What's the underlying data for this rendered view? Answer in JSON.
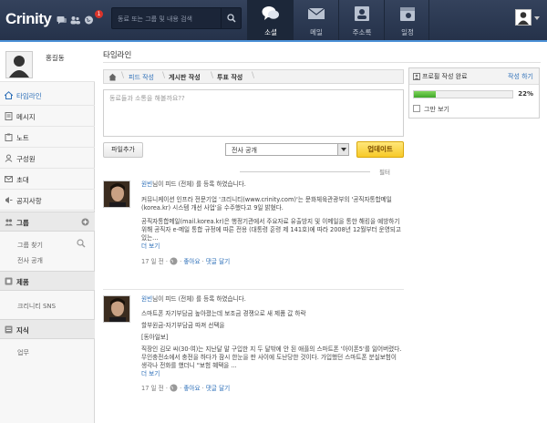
{
  "app": {
    "logo": "Crinity"
  },
  "topbar": {
    "notification_count": "1",
    "search": {
      "placeholder": "동료 또는 그룹 및 내용 검색"
    },
    "nav": [
      {
        "label": "소셜",
        "icon": "chat-bubbles-icon",
        "active": true
      },
      {
        "label": "메일",
        "icon": "envelope-icon",
        "active": false
      },
      {
        "label": "주소록",
        "icon": "contacts-icon",
        "active": false
      },
      {
        "label": "일정",
        "icon": "calendar-icon",
        "active": false
      }
    ]
  },
  "sidebar": {
    "user_name": "홍길동",
    "items": [
      {
        "label": "타임라인",
        "icon": "home-icon",
        "active": true
      },
      {
        "label": "메시지",
        "icon": "message-icon"
      },
      {
        "label": "노트",
        "icon": "note-icon"
      },
      {
        "label": "구성원",
        "icon": "member-icon"
      },
      {
        "label": "초대",
        "icon": "invite-icon"
      },
      {
        "label": "공지사항",
        "icon": "megaphone-icon"
      }
    ],
    "group": {
      "label": "그룹",
      "subitems": [
        "그룹 찾기",
        "전사 공개"
      ]
    },
    "products": {
      "label": "제품",
      "subitems": [
        "크리니티 SNS"
      ]
    },
    "knowledge": {
      "label": "지식",
      "subitems": [
        "업무"
      ]
    }
  },
  "main": {
    "title": "타임라인",
    "composer": {
      "tabs": [
        "피드 작성",
        "게시판 작성",
        "투표 작성"
      ],
      "placeholder": "동료들과 소통을 해볼까요??",
      "attach_label": "파일추가",
      "scope_value": "전사 공개",
      "update_label": "업데이트"
    },
    "filter_label": "필터",
    "posts": [
      {
        "author": "원빈",
        "action": "님이 피드 (전체) 를 등록 하였습니다.",
        "paragraphs": [
          "커뮤니케이션 인프라 전문기업 '크리니티(www.crinity.com)'는 문화체육관광부의 '공직자통합메일(korea.kr) 시스템 개선 사업'을 수주했다고 9일 밝혔다.",
          "공직자통합메일(mail.korea.kr)은 행정기관에서 주요자료 유출방지 및 이메일을 통한 해킹을 예방하기 위해 공직자 e-메일 통합 규정에 따른 전용 (대통령 훈령 제 141호)에 따라 2008년 12월부터 운영되고 있는..."
        ],
        "more": "더 보기",
        "time": "17 일 전",
        "like": "좋아요",
        "comment": "댓글 달기"
      },
      {
        "author": "원빈",
        "action": "님이 피드 (전체) 를 등록 하였습니다.",
        "paragraphs": [
          "스마트폰 자기부담금 높아졌는데 보조금 경쟁으로 새 제품 값 하락",
          "할부원금-자기부담금 따져 선택을",
          "[동아일보]",
          "직장인 김모 씨(30·여)는 지난달 말 구입한 지 두 달밖에 안 된 애플의 스마트폰 '아이폰5'를 잃어버렸다. 무인충전소에서 충전을 하다가 잠시 한눈을 판 사이에 도난당한 것이다. 가입했던 스마트폰 분실보험이 생각나 전화를 했더니 \"보험 혜택을 ..."
        ],
        "more": "더 보기",
        "time": "17 일 전",
        "like": "좋아요",
        "comment": "댓글 달기"
      }
    ]
  },
  "profile_progress": {
    "title": "프로필 작성 완료",
    "later": "작성 하기",
    "percent_label": "22%",
    "percent": 0.22,
    "hide_label": "그만 보기"
  },
  "colors": {
    "topbar": "#2b3850",
    "accent": "#4a90d6",
    "link": "#2d6fb8",
    "update_button": "#f7c928",
    "progress": "#52b83a"
  }
}
